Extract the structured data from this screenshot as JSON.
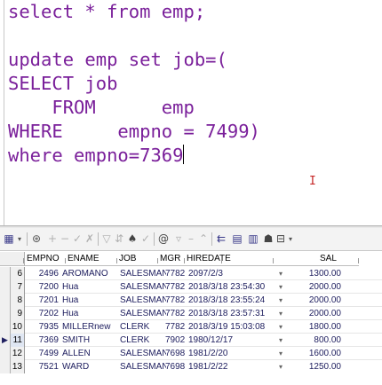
{
  "editor": {
    "lines": [
      "select * from emp;",
      "",
      "update emp set job=(",
      "SELECT job",
      "    FROM      emp",
      "WHERE     empno = ",
      "where empno=7369"
    ],
    "line6_number": "7499)",
    "caret_visible": true
  },
  "toolbar": {
    "icons": [
      "grid-icon",
      "refresh-icon",
      "add-icon",
      "remove-icon",
      "post-icon",
      "cancel-icon",
      "filter-icon",
      "sort-icon",
      "query-by-example-icon",
      "find-icon",
      "prev-icon",
      "next-icon",
      "lock-icon",
      "wrap-icon",
      "pin-icon",
      "chart-icon"
    ]
  },
  "grid": {
    "columns": [
      "EMPNO",
      "ENAME",
      "JOB",
      "MGR",
      "HIREDATE",
      "SAL"
    ],
    "current_row_indicator": "▶",
    "rows": [
      {
        "n": "6",
        "empno": "2496",
        "ename": "AROMANO",
        "job": "SALESMAN",
        "mgr": "7782",
        "hiredate": "2097/2/3",
        "sal": "1300.00"
      },
      {
        "n": "7",
        "empno": "7200",
        "ename": "Hua",
        "job": "SALESMAN",
        "mgr": "7782",
        "hiredate": "2018/3/18 23:54:30",
        "sal": "2000.00"
      },
      {
        "n": "8",
        "empno": "7201",
        "ename": "Hua",
        "job": "SALESMAN",
        "mgr": "7782",
        "hiredate": "2018/3/18 23:55:24",
        "sal": "2000.00"
      },
      {
        "n": "9",
        "empno": "7202",
        "ename": "Hua",
        "job": "SALESMAN",
        "mgr": "7782",
        "hiredate": "2018/3/18 23:57:31",
        "sal": "2000.00"
      },
      {
        "n": "10",
        "empno": "7935",
        "ename": "MILLERnew",
        "job": "CLERK",
        "mgr": "7782",
        "hiredate": "2018/3/19 15:03:08",
        "sal": "1800.00"
      },
      {
        "n": "11",
        "empno": "7369",
        "ename": "SMITH",
        "job": "CLERK",
        "mgr": "7902",
        "hiredate": "1980/12/17",
        "sal": "800.00"
      },
      {
        "n": "12",
        "empno": "7499",
        "ename": "ALLEN",
        "job": "SALESMAN",
        "mgr": "7698",
        "hiredate": "1981/2/20",
        "sal": "1600.00"
      },
      {
        "n": "13",
        "empno": "7521",
        "ename": "WARD",
        "job": "SALESMAN",
        "mgr": "7698",
        "hiredate": "1981/2/22",
        "sal": "1250.00"
      }
    ]
  }
}
